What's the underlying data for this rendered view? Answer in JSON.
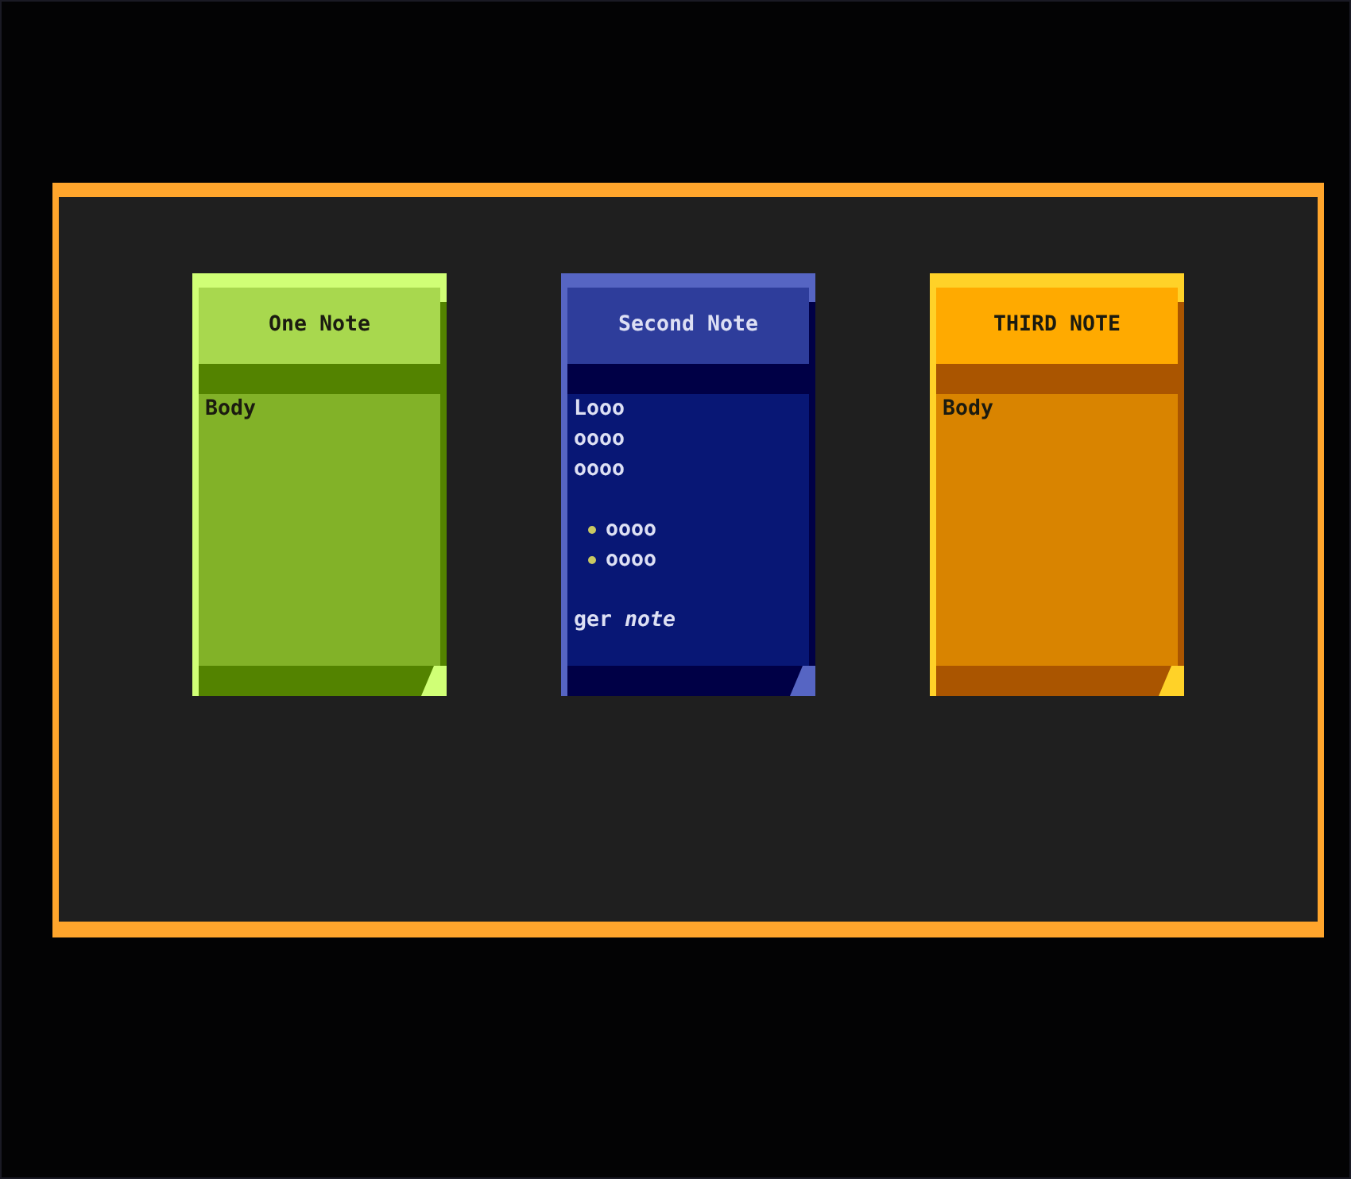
{
  "notes": [
    {
      "title": "One Note",
      "color": "#a8d84e",
      "body": [
        {
          "kind": "paragraph",
          "lines": [
            "Body"
          ]
        }
      ]
    },
    {
      "title": "Second Note",
      "color": "#2e3d9b",
      "body": [
        {
          "kind": "paragraph",
          "lines": [
            "Looo",
            "oooo",
            "oooo"
          ]
        },
        {
          "kind": "list",
          "items": [
            "oooo",
            "oooo"
          ]
        },
        {
          "kind": "paragraph",
          "lines": [
            "ger *note*"
          ]
        }
      ]
    },
    {
      "title": "THIRD NOTE",
      "color": "#ffaa00",
      "body": [
        {
          "kind": "paragraph",
          "lines": [
            "Body"
          ]
        }
      ]
    }
  ]
}
